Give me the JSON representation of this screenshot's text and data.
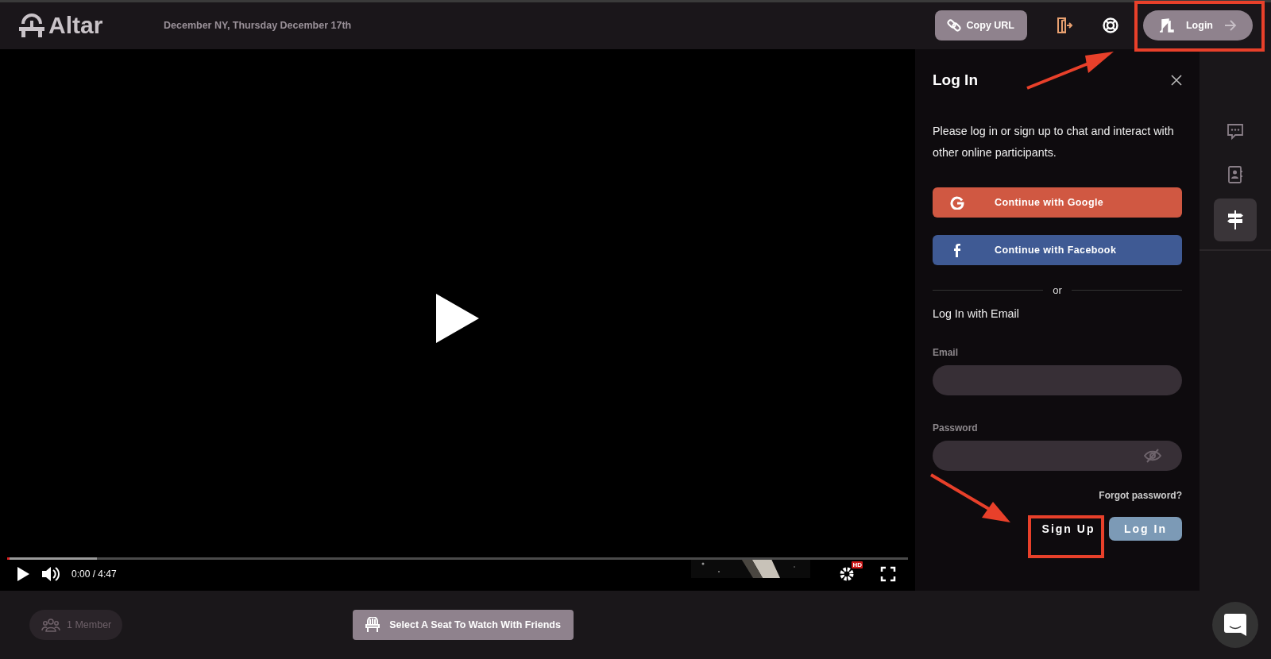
{
  "header": {
    "logo": "Altar",
    "event": "December NY, Thursday December 17th",
    "copy_button": "Copy URL",
    "login_button": "Login"
  },
  "video": {
    "progress": {
      "level": 0.1
    },
    "time": "0:00 / 4:47",
    "hd_badge": "HD"
  },
  "login_panel": {
    "title": "Log In",
    "description": "Please log in or sign up to chat and interact with other online participants.",
    "social_buttons": [
      {
        "kind": "google",
        "label": "Continue with Google"
      },
      {
        "kind": "facebook",
        "label": "Continue with Facebook"
      }
    ],
    "divider": "or",
    "email_heading": "Log In with Email",
    "email_label": "Email",
    "password_label": "Password",
    "forgot": "Forgot password?",
    "signup_button": "Sign Up",
    "login_button": "Log In"
  },
  "rail": [
    {
      "kind": "chat",
      "selected": false
    },
    {
      "kind": "contacts",
      "selected": false
    },
    {
      "kind": "signpost",
      "selected": true
    }
  ],
  "footer": {
    "members": "1 Member",
    "seat_button": "Select A Seat To Watch With Friends"
  }
}
